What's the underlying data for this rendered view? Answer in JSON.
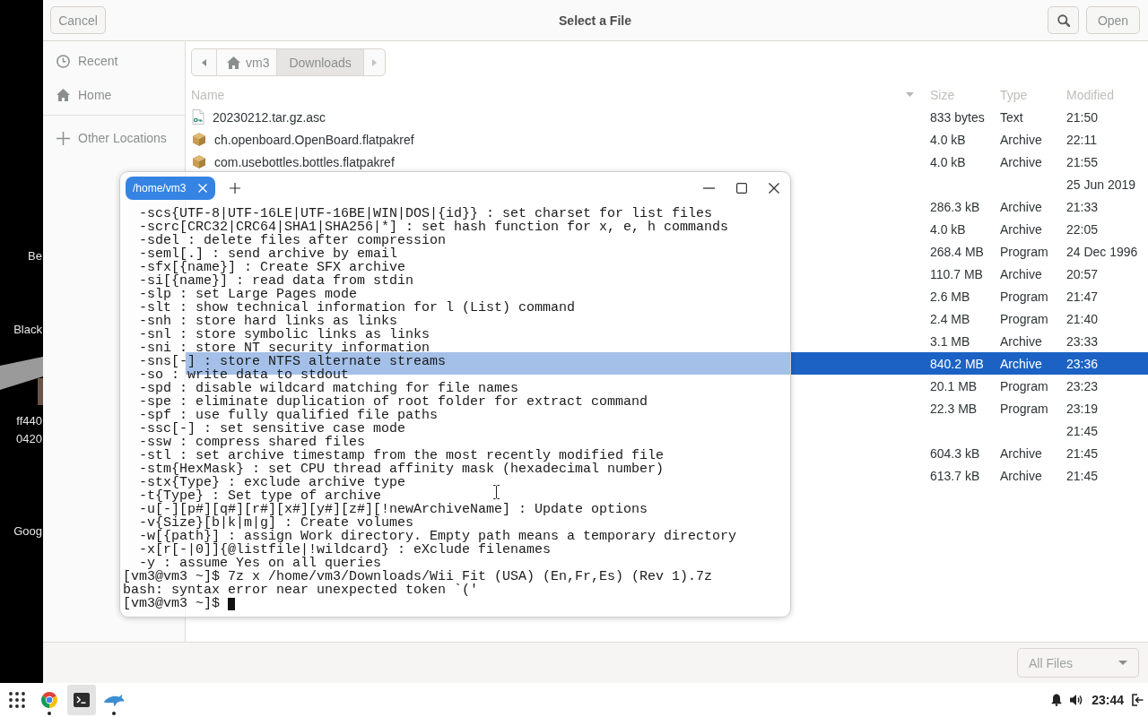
{
  "dialog": {
    "cancel": "Cancel",
    "title": "Select a File",
    "open": "Open"
  },
  "sidebar": {
    "places": [
      {
        "label": "Recent",
        "kind": "recent",
        "selected": false
      },
      {
        "label": "Home",
        "kind": "home",
        "selected": false
      }
    ],
    "other": {
      "label": "Other Locations",
      "kind": "add"
    }
  },
  "path_bar": {
    "segments": [
      {
        "label": "vm3",
        "kind": "home",
        "selected": false
      },
      {
        "label": "Downloads",
        "selected": true
      }
    ]
  },
  "files": {
    "columns": [
      {
        "label": "Name",
        "sorted": true
      },
      {
        "label": "Size",
        "sorted": false
      },
      {
        "label": "Type",
        "sorted": false
      },
      {
        "label": "Modified",
        "sorted": false
      }
    ],
    "rows": [
      {
        "kind": "text-file",
        "name": "20230212.tar.gz.asc",
        "size": "833 bytes",
        "type": "Text",
        "modified": "21:50",
        "selected": false
      },
      {
        "kind": "package",
        "name": "ch.openboard.OpenBoard.flatpakref",
        "size": "4.0 kB",
        "type": "Archive",
        "modified": "22:11",
        "selected": false
      },
      {
        "kind": "package",
        "name": "com.usebottles.bottles.flatpakref",
        "size": "4.0 kB",
        "type": "Archive",
        "modified": "21:55",
        "selected": false
      },
      {
        "modified": "25 Jun 2019",
        "selected": false
      },
      {
        "size": "286.3 kB",
        "type": "Archive",
        "modified": "21:33",
        "selected": false
      },
      {
        "size": "4.0 kB",
        "type": "Archive",
        "modified": "22:05",
        "selected": false
      },
      {
        "size": "268.4 MB",
        "type": "Program",
        "modified": "24 Dec 1996",
        "selected": false
      },
      {
        "size": "110.7 MB",
        "type": "Archive",
        "modified": "20:57",
        "selected": false
      },
      {
        "size": "2.6 MB",
        "type": "Program",
        "modified": "21:47",
        "selected": false
      },
      {
        "size": "2.4 MB",
        "type": "Program",
        "modified": "21:40",
        "selected": false
      },
      {
        "size": "3.1 MB",
        "type": "Archive",
        "modified": "23:33",
        "selected": false
      },
      {
        "size": "840.2 MB",
        "type": "Archive",
        "modified": "23:36",
        "selected": true
      },
      {
        "size": "20.1 MB",
        "type": "Program",
        "modified": "23:23",
        "selected": false
      },
      {
        "size": "22.3 MB",
        "type": "Program",
        "modified": "23:19",
        "selected": false
      },
      {
        "modified": "21:45",
        "selected": false
      },
      {
        "size": "604.3 kB",
        "type": "Archive",
        "modified": "21:45",
        "selected": false
      },
      {
        "size": "613.7 kB",
        "type": "Archive",
        "modified": "21:45",
        "selected": false
      }
    ]
  },
  "filter": {
    "value": "All Files"
  },
  "terminal": {
    "tabs": [
      {
        "title": "/home/vm3",
        "selected": true
      }
    ],
    "lines": [
      {
        "kind": "option",
        "text": "-scs{UTF-8|UTF-16LE|UTF-16BE|WIN|DOS|{id}} : set charset for list files"
      },
      {
        "kind": "option",
        "text": "-scrc[CRC32|CRC64|SHA1|SHA256|*] : set hash function for x, e, h commands"
      },
      {
        "kind": "option",
        "text": "-sdel : delete files after compression"
      },
      {
        "kind": "option",
        "text": "-seml[.] : send archive by email"
      },
      {
        "kind": "option",
        "text": "-sfx[{name}] : Create SFX archive"
      },
      {
        "kind": "option",
        "text": "-si[{name}] : read data from stdin"
      },
      {
        "kind": "option",
        "text": "-slp : set Large Pages mode"
      },
      {
        "kind": "option",
        "text": "-slt : show technical information for l (List) command"
      },
      {
        "kind": "option",
        "text": "-snh : store hard links as links"
      },
      {
        "kind": "option",
        "text": "-snl : store symbolic links as links"
      },
      {
        "kind": "option",
        "text": "-sni : store NT security information"
      },
      {
        "kind": "option",
        "text": "-sns[-] : store NTFS alternate streams"
      },
      {
        "kind": "option",
        "text": "-so : write data to stdout"
      },
      {
        "kind": "option",
        "text": "-spd : disable wildcard matching for file names"
      },
      {
        "kind": "option",
        "text": "-spe : eliminate duplication of root folder for extract command"
      },
      {
        "kind": "option",
        "text": "-spf : use fully qualified file paths"
      },
      {
        "kind": "option",
        "text": "-ssc[-] : set sensitive case mode"
      },
      {
        "kind": "option",
        "text": "-ssw : compress shared files"
      },
      {
        "kind": "option",
        "text": "-stl : set archive timestamp from the most recently modified file"
      },
      {
        "kind": "option",
        "text": "-stm{HexMask} : set CPU thread affinity mask (hexadecimal number)"
      },
      {
        "kind": "option",
        "text": "-stx{Type} : exclude archive type"
      },
      {
        "kind": "option",
        "text": "-t{Type} : Set type of archive"
      },
      {
        "kind": "option",
        "text": "-u[-][p#][q#][r#][x#][y#][z#][!newArchiveName] : Update options"
      },
      {
        "kind": "option",
        "text": "-v{Size}[b|k|m|g] : Create volumes"
      },
      {
        "kind": "option",
        "text": "-w[{path}] : assign Work directory. Empty path means a temporary directory"
      },
      {
        "kind": "option",
        "text": "-x[r[-|0]]{@listfile|!wildcard} : eXclude filenames"
      },
      {
        "kind": "option",
        "text": "-y : assume Yes on all queries"
      },
      {
        "kind": "command",
        "text": "[vm3@vm3 ~]$ 7z x /home/vm3/Downloads/Wii Fit (USA) (En,Fr,Es) (Rev 1).7z"
      },
      {
        "kind": "output",
        "text": "bash: syntax error near unexpected token `('"
      },
      {
        "kind": "prompt",
        "text": "[vm3@vm3 ~]$"
      }
    ]
  },
  "desktop": {
    "labels": [
      "Be",
      "Black",
      "ff440",
      "0420",
      "Goog"
    ]
  },
  "taskbar": {
    "apps": [
      {
        "kind": "launcher",
        "selected": false,
        "running": false
      },
      {
        "kind": "browser",
        "selected": false,
        "running": true
      },
      {
        "kind": "terminal",
        "selected": true,
        "running": false
      },
      {
        "kind": "dolphin",
        "selected": false,
        "running": true
      }
    ],
    "clock": "23:44"
  }
}
